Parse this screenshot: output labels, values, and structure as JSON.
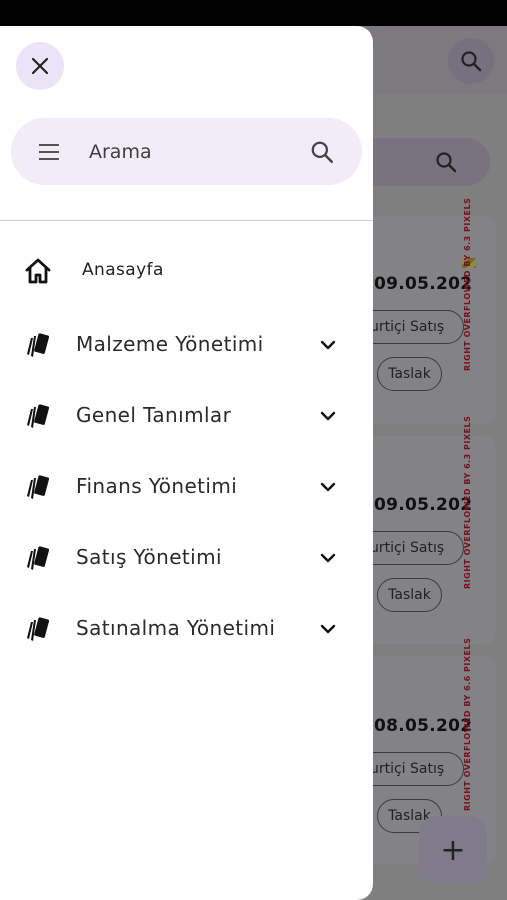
{
  "background": {
    "cards": [
      {
        "date": "09.05.202",
        "sale_type": "Yurtiçi Satış",
        "status": "Taslak",
        "overflow": "RIGHT OVERFLOWED BY 6.3 PIXELS"
      },
      {
        "date": "09.05.202",
        "sale_type": "Yurtiçi Satış",
        "status": "Taslak",
        "overflow": "RIGHT OVERFLOWED BY 6.3 PIXELS"
      },
      {
        "date": "08.05.202",
        "sale_type": "Yurtiçi Satış",
        "status": "Taslak",
        "overflow": "RIGHT OVERFLOWED BY 6.6 PIXELS"
      }
    ],
    "fab_icon": "+"
  },
  "drawer": {
    "search": {
      "placeholder": "Arama"
    },
    "home": {
      "label": "Anasayfa",
      "icon": "home-icon"
    },
    "menu": [
      {
        "label": "Malzeme Yönetimi",
        "icon": "cards-icon"
      },
      {
        "label": "Genel Tanımlar",
        "icon": "cards-icon"
      },
      {
        "label": "Finans Yönetimi",
        "icon": "cards-icon"
      },
      {
        "label": "Satış Yönetimi",
        "icon": "cards-icon"
      },
      {
        "label": "Satınalma Yönetimi",
        "icon": "cards-icon"
      }
    ]
  },
  "colors": {
    "accent_surface": "#ebe3f8",
    "search_surface": "#f2ecf8",
    "scrim": "#7f7f7f"
  }
}
